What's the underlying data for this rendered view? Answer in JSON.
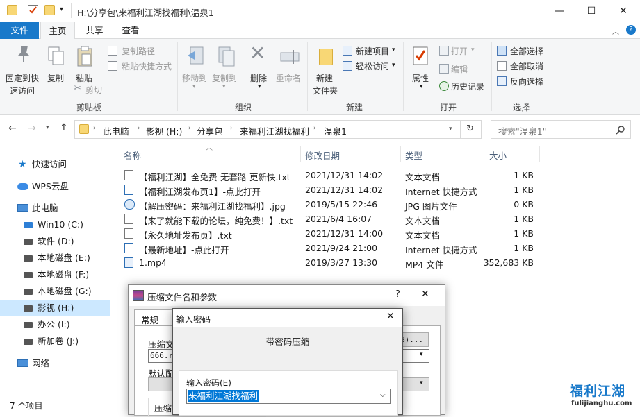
{
  "window": {
    "title": "H:\\分享包\\来福利江湖找福利\\温泉1",
    "controls": {
      "minimize": "—",
      "maximize": "☐",
      "close": "✕"
    }
  },
  "tabs": {
    "file": "文件",
    "home": "主页",
    "share": "共享",
    "view": "查看"
  },
  "ribbon": {
    "clipboard": {
      "pin": "固定到快速访问",
      "pin_line1": "固定到快",
      "pin_line2": "速访问",
      "copy": "复制",
      "paste": "粘贴",
      "copy_path": "复制路径",
      "paste_shortcut": "粘贴快捷方式",
      "cut": "剪切",
      "label": "剪贴板"
    },
    "organize": {
      "move_to": "移动到",
      "copy_to": "复制到",
      "delete": "删除",
      "rename": "重命名",
      "label": "组织"
    },
    "new": {
      "new_folder_l1": "新建",
      "new_folder_l2": "文件夹",
      "new_item": "新建项目",
      "easy_access": "轻松访问",
      "label": "新建"
    },
    "open": {
      "properties": "属性",
      "open": "打开",
      "edit": "编辑",
      "history": "历史记录",
      "label": "打开"
    },
    "select": {
      "select_all": "全部选择",
      "select_none": "全部取消",
      "invert": "反向选择",
      "label": "选择"
    }
  },
  "address": {
    "crumbs": [
      "此电脑",
      "影视 (H:)",
      "分享包",
      "来福利江湖找福利",
      "温泉1"
    ],
    "search_placeholder": "搜索\"温泉1\""
  },
  "nav": {
    "items": [
      {
        "label": "快速访问"
      },
      {
        "label": "WPS云盘"
      },
      {
        "label": "此电脑"
      },
      {
        "label": "Win10 (C:)"
      },
      {
        "label": "软件 (D:)"
      },
      {
        "label": "本地磁盘 (E:)"
      },
      {
        "label": "本地磁盘 (F:)"
      },
      {
        "label": "本地磁盘 (G:)"
      },
      {
        "label": "影视 (H:)"
      },
      {
        "label": "办公 (I:)"
      },
      {
        "label": "新加卷 (J:)"
      },
      {
        "label": "网络"
      }
    ]
  },
  "columns": {
    "name": "名称",
    "modified": "修改日期",
    "type": "类型",
    "size": "大小"
  },
  "files": [
    {
      "name": "【福利江湖】全免费-无套路-更新快.txt",
      "date": "2021/12/31 14:02",
      "type": "文本文档",
      "size": "1 KB"
    },
    {
      "name": "【福利江湖发布页1】-点此打开",
      "date": "2021/12/31 14:02",
      "type": "Internet 快捷方式",
      "size": "1 KB"
    },
    {
      "name": "【解压密码：来福利江湖找福利】.jpg",
      "date": "2019/5/15 22:46",
      "type": "JPG 图片文件",
      "size": "0 KB"
    },
    {
      "name": "【来了就能下载的论坛，纯免费！】.txt",
      "date": "2021/6/4 16:07",
      "type": "文本文档",
      "size": "1 KB"
    },
    {
      "name": "【永久地址发布页】.txt",
      "date": "2021/12/31 14:00",
      "type": "文本文档",
      "size": "1 KB"
    },
    {
      "name": "【最新地址】-点此打开",
      "date": "2021/9/24 21:00",
      "type": "Internet 快捷方式",
      "size": "1 KB"
    },
    {
      "name": "1.mp4",
      "date": "2019/3/27 13:30",
      "type": "MP4 文件",
      "size": "352,683 KB"
    }
  ],
  "status": {
    "count": "7 个项目"
  },
  "archive_dialog": {
    "title": "压缩文件名和参数",
    "help": "?",
    "close": "✕",
    "tab_general": "常规",
    "archive_name_label": "压缩文",
    "archive_name_value": "666.r",
    "browse_suffix": "B)...",
    "default_label": "默认配",
    "compress_label": "压缩"
  },
  "password_dialog": {
    "title": "输入密码",
    "close": "✕",
    "heading": "带密码压缩",
    "field_label": "输入密码(E)",
    "field_value": "来福利江湖找福利"
  },
  "watermark": {
    "brand": "福利江湖",
    "url": "fulijianghu.com"
  },
  "colors": {
    "accent": "#1979ca",
    "selection": "#cce8ff",
    "text_selection": "#0078d7"
  }
}
